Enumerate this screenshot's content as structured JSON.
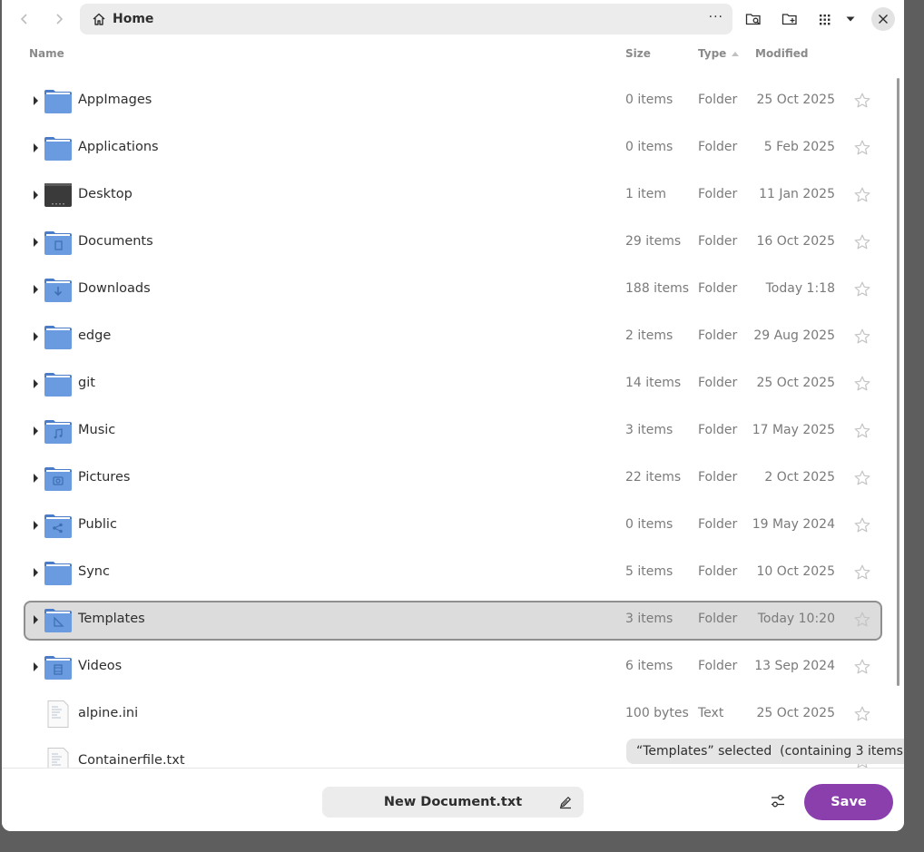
{
  "header": {
    "path_crumb": "Home",
    "more_label": "···"
  },
  "columns": {
    "name": "Name",
    "size": "Size",
    "type": "Type",
    "modified": "Modified",
    "sort_indicator": "ascending"
  },
  "files": [
    {
      "name": "AppImages",
      "size": "0 items",
      "type": "Folder",
      "modified": "25 Oct 2025",
      "icon": "folder-icon",
      "expandable": true
    },
    {
      "name": "Applications",
      "size": "0 items",
      "type": "Folder",
      "modified": "5 Feb 2025",
      "icon": "folder-icon",
      "expandable": true
    },
    {
      "name": "Desktop",
      "size": "1 item",
      "type": "Folder",
      "modified": "11 Jan 2025",
      "icon": "desktop-folder-icon",
      "expandable": true
    },
    {
      "name": "Documents",
      "size": "29 items",
      "type": "Folder",
      "modified": "16 Oct 2025",
      "icon": "documents-folder-icon",
      "expandable": true
    },
    {
      "name": "Downloads",
      "size": "188 items",
      "type": "Folder",
      "modified": "Today 1:18",
      "icon": "downloads-folder-icon",
      "expandable": true
    },
    {
      "name": "edge",
      "size": "2 items",
      "type": "Folder",
      "modified": "29 Aug 2025",
      "icon": "folder-icon",
      "expandable": true
    },
    {
      "name": "git",
      "size": "14 items",
      "type": "Folder",
      "modified": "25 Oct 2025",
      "icon": "folder-icon",
      "expandable": true
    },
    {
      "name": "Music",
      "size": "3 items",
      "type": "Folder",
      "modified": "17 May 2025",
      "icon": "music-folder-icon",
      "expandable": true
    },
    {
      "name": "Pictures",
      "size": "22 items",
      "type": "Folder",
      "modified": "2 Oct 2025",
      "icon": "pictures-folder-icon",
      "expandable": true
    },
    {
      "name": "Public",
      "size": "0 items",
      "type": "Folder",
      "modified": "19 May 2024",
      "icon": "public-folder-icon",
      "expandable": true
    },
    {
      "name": "Sync",
      "size": "5 items",
      "type": "Folder",
      "modified": "10 Oct 2025",
      "icon": "folder-icon",
      "expandable": true
    },
    {
      "name": "Templates",
      "size": "3 items",
      "type": "Folder",
      "modified": "Today 10:20",
      "icon": "templates-folder-icon",
      "expandable": true,
      "selected": true
    },
    {
      "name": "Videos",
      "size": "6 items",
      "type": "Folder",
      "modified": "13 Sep 2024",
      "icon": "videos-folder-icon",
      "expandable": true
    },
    {
      "name": "alpine.ini",
      "size": "100 bytes",
      "type": "Text",
      "modified": "25 Oct 2025",
      "icon": "text-file-icon",
      "expandable": false
    },
    {
      "name": "Containerfile.txt",
      "size": "",
      "type": "",
      "modified": "",
      "icon": "text-file-icon",
      "expandable": false
    }
  ],
  "status_toast": "“Templates” selected  (containing 3 items)",
  "footer": {
    "filename_value": "New Document.txt",
    "save_label": "Save"
  },
  "colors": {
    "accent": "#8a3fad",
    "folder": "#6a9be0",
    "selection": "#dcdcdc"
  }
}
